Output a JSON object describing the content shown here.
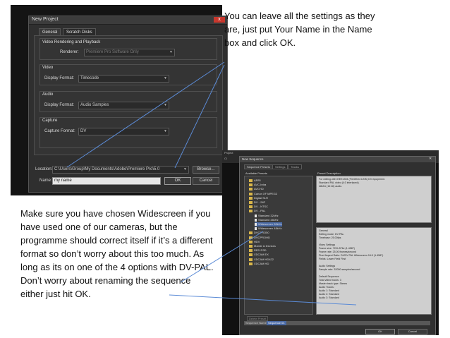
{
  "new_project": {
    "title": "New Project",
    "close": "x",
    "tabs": [
      "General",
      "Scratch Disks"
    ],
    "video_rendering": {
      "title": "Video Rendering and Playback",
      "renderer_label": "Renderer:",
      "renderer_value": "Premiere Pro Software Only"
    },
    "video": {
      "title": "Video",
      "display_format_label": "Display Format:",
      "display_format_value": "Timecode"
    },
    "audio": {
      "title": "Audio",
      "display_format_label": "Display Format:",
      "display_format_value": "Audio Samples"
    },
    "capture": {
      "title": "Capture",
      "capture_format_label": "Capture Format:",
      "capture_format_value": "DV"
    },
    "location_label": "Location:",
    "location_value": "C:\\Users\\Group\\My Documents\\Adobe\\Premiere Pro\\5.0",
    "browse_label": "Browse...",
    "name_label": "Name:",
    "name_value": "my name",
    "ok_label": "OK",
    "cancel_label": "Cancel"
  },
  "callouts": {
    "top_right": "You can leave all the settings as they are, just put Your Name in the Name box and click OK.",
    "left": "Make sure you have chosen Widescreen if you have used one of our cameras, but the programme should correct itself if it’s a different format so don’t worry about this too much. As long as its on one of the 4 options with DV-PAL. Don’t worry about renaming the sequence either just hit OK."
  },
  "new_sequence": {
    "title": "New Sequence",
    "menu": [
      "Project",
      "Cl"
    ],
    "tabs": [
      "Sequence Presets",
      "Settings",
      "Tracks"
    ],
    "available_presets_label": "Available Presets",
    "preset_description_label": "Preset Description",
    "presets": [
      {
        "label": "ARRI",
        "kind": "folder",
        "selected": false
      },
      {
        "label": "AVC-Intra",
        "kind": "folder",
        "selected": false
      },
      {
        "label": "AVCHD",
        "kind": "folder",
        "selected": false
      },
      {
        "label": "Canon XF MPEG2",
        "kind": "folder",
        "selected": false
      },
      {
        "label": "Digital SLR",
        "kind": "folder",
        "selected": false
      },
      {
        "label": "DV - 24P",
        "kind": "folder",
        "selected": false
      },
      {
        "label": "DV - NTSC",
        "kind": "folder",
        "selected": false
      },
      {
        "label": "DV - PAL",
        "kind": "folder",
        "selected": false
      },
      {
        "label": "Standard 32kHz",
        "kind": "file",
        "selected": false
      },
      {
        "label": "Standard 48kHz",
        "kind": "file",
        "selected": false
      },
      {
        "label": "Widescreen 32kHz",
        "kind": "file",
        "selected": true
      },
      {
        "label": "Widescreen 48kHz",
        "kind": "file",
        "selected": false
      },
      {
        "label": "DVCPRO50",
        "kind": "folder",
        "selected": false
      },
      {
        "label": "DVCPROHD",
        "kind": "folder",
        "selected": false
      },
      {
        "label": "HDV",
        "kind": "folder",
        "selected": false
      },
      {
        "label": "Mobile & Devices",
        "kind": "folder",
        "selected": false
      },
      {
        "label": "RED R3D",
        "kind": "folder",
        "selected": false
      },
      {
        "label": "XDCAM EX",
        "kind": "folder",
        "selected": false
      },
      {
        "label": "XDCAM HD422",
        "kind": "folder",
        "selected": false
      },
      {
        "label": "XDCAM HD",
        "kind": "folder",
        "selected": false
      }
    ],
    "description_top": "For editing with IEEE1394 (FireWire/i.LINK) DV equipment.\nStandard PAL video (4:3 interlaced).\n48kHz (16 bit) audio.",
    "description_bottom": "General\nEditing mode: DV PAL\nTimebase: 25.00fps\n\nVideo Settings\nFrame size: 720h 576v (1.4587)\nFrame rate: 25.00 frames/second\nPixel Aspect Ratio: D1/DV PAL Widescreen 16:9 (1.4587)\nFields: Lower Field First\n\nAudio Settings\nSample rate: 32000 samples/second\n\nDefault Sequence\nTotal video tracks: 3\nMaster track type: Stereo\nAudio Tracks:\nAudio 1: Standard\nAudio 2: Standard\nAudio 3: Standard",
    "delete_preset_label": "Delete Preset",
    "sequence_name_label": "Sequence Name:",
    "sequence_name_value": "Sequence 01",
    "ok_label": "OK",
    "cancel_label": "Cancel"
  }
}
